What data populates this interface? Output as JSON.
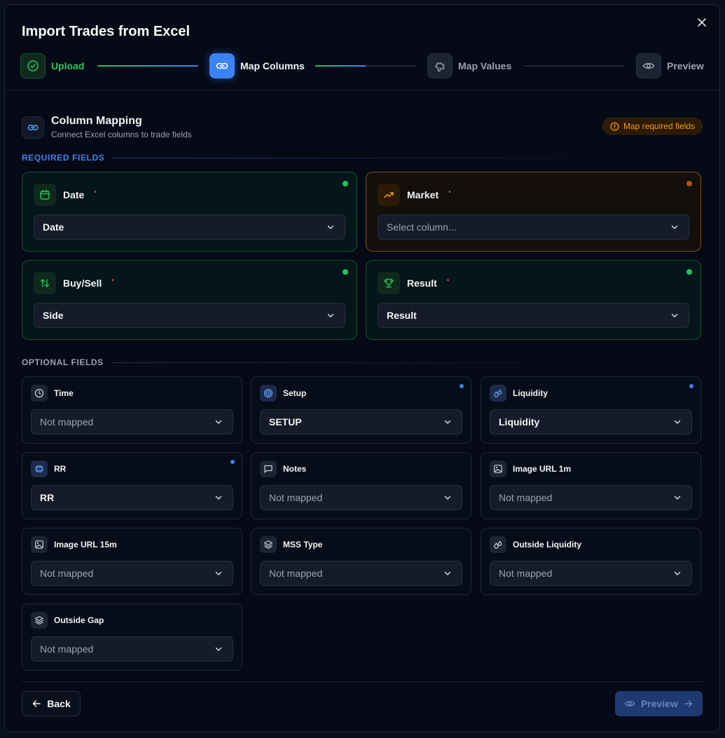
{
  "modal": {
    "title": "Import Trades from Excel"
  },
  "steps": [
    {
      "label": "Upload",
      "state": "done"
    },
    {
      "label": "Map Columns",
      "state": "active"
    },
    {
      "label": "Map Values",
      "state": "pending"
    },
    {
      "label": "Preview",
      "state": "pending"
    }
  ],
  "progress": [
    1.0,
    0.5,
    0.0
  ],
  "section": {
    "title": "Column Mapping",
    "subtitle": "Connect Excel columns to trade fields",
    "badge": "Map required fields"
  },
  "required": {
    "label": "REQUIRED FIELDS",
    "fields": [
      {
        "label": "Date",
        "value": "Date",
        "mapped": true
      },
      {
        "label": "Market",
        "value": "Select column...",
        "mapped": false
      },
      {
        "label": "Buy/Sell",
        "value": "Side",
        "mapped": true
      },
      {
        "label": "Result",
        "value": "Result",
        "mapped": true
      }
    ]
  },
  "optional": {
    "label": "OPTIONAL FIELDS",
    "fields": [
      {
        "label": "Time",
        "value": "Not mapped",
        "mapped": false
      },
      {
        "label": "Setup",
        "value": "SETUP",
        "mapped": true
      },
      {
        "label": "Liquidity",
        "value": "Liquidity",
        "mapped": true
      },
      {
        "label": "RR",
        "value": "RR",
        "mapped": true
      },
      {
        "label": "Notes",
        "value": "Not mapped",
        "mapped": false
      },
      {
        "label": "Image URL 1m",
        "value": "Not mapped",
        "mapped": false
      },
      {
        "label": "Image URL 15m",
        "value": "Not mapped",
        "mapped": false
      },
      {
        "label": "MSS Type",
        "value": "Not mapped",
        "mapped": false
      },
      {
        "label": "Outside Liquidity",
        "value": "Not mapped",
        "mapped": false
      },
      {
        "label": "Outside Gap",
        "value": "Not mapped",
        "mapped": false
      }
    ]
  },
  "footer": {
    "back_label": "Back",
    "preview_label": "Preview"
  },
  "colors": {
    "green": "#22c55e",
    "blue": "#3b82f6",
    "amber": "#f59e0b",
    "red": "#ef4444",
    "background": "#060a16"
  },
  "icons": {
    "steps": [
      "check-circle-icon",
      "link-icon",
      "puzzle-icon",
      "eye-icon"
    ],
    "required": [
      "calendar-icon",
      "trending-up-icon",
      "arrows-up-down-icon",
      "trophy-icon"
    ],
    "optional": [
      "clock-icon",
      "target-icon",
      "droplets-icon",
      "frame-icon",
      "message-icon",
      "image-icon",
      "image-icon",
      "layers-icon",
      "droplets-icon",
      "layers-icon"
    ]
  }
}
